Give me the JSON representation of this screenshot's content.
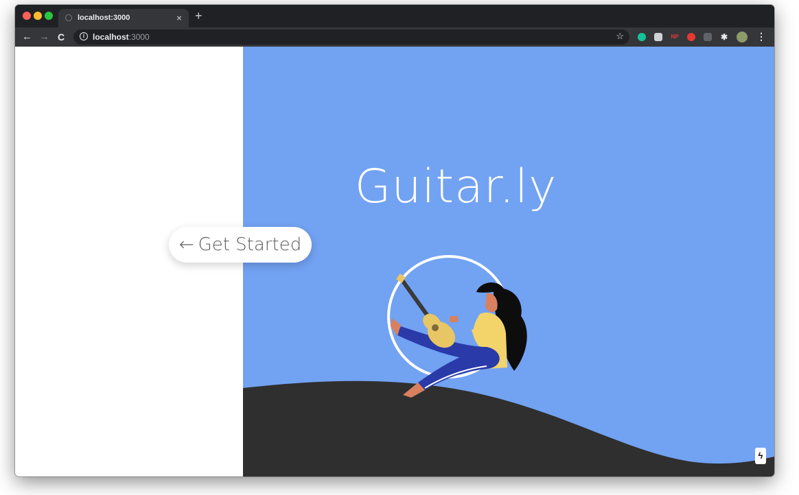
{
  "browser": {
    "tab": {
      "title": "localhost:3000",
      "close": "×"
    },
    "new_tab": "+",
    "nav": {
      "back": "←",
      "forward": "→",
      "reload": "C"
    },
    "address": {
      "host": "localhost",
      "port": ":3000"
    },
    "extensions": [
      "grammarly-icon",
      "mail-icon",
      "np-extension-icon",
      "record-icon",
      "copy-icon",
      "puzzle-icon",
      "profile-avatar"
    ],
    "extension_labels": {
      "np": "NP"
    }
  },
  "page": {
    "brand": "Guitar.ly",
    "cta": {
      "arrow": "←",
      "label": "Get Started"
    },
    "badge": "ϟ"
  },
  "colors": {
    "hero": "#72a2f2",
    "ground": "#2f2f2f",
    "shirt": "#f2d46b",
    "pants": "#2a3aa8",
    "guitar": "#e8c664"
  }
}
